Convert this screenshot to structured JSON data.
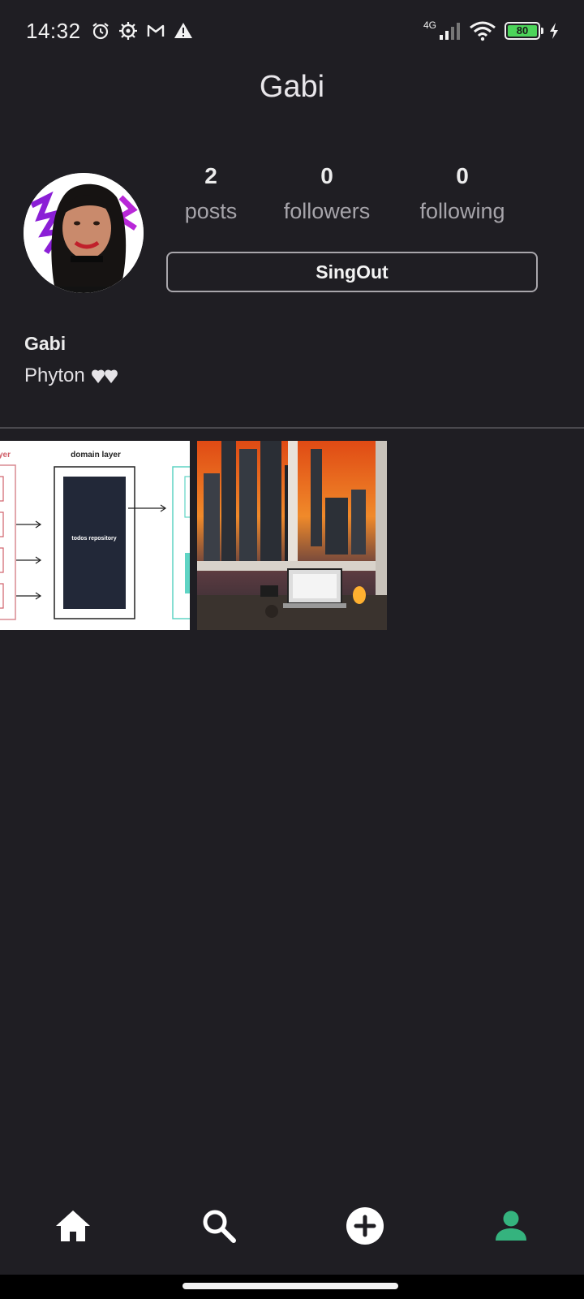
{
  "status_bar": {
    "time": "14:32",
    "icons_left": [
      "alarm-icon",
      "settings-icon",
      "gmail-icon",
      "warning-icon"
    ],
    "network": "4G",
    "battery": "80",
    "icons_right": [
      "signal-icon",
      "wifi-icon",
      "battery-icon",
      "charging-icon"
    ]
  },
  "app_bar": {
    "title": "Gabi"
  },
  "profile": {
    "stats": [
      {
        "value": "2",
        "label": "posts"
      },
      {
        "value": "0",
        "label": "followers"
      },
      {
        "value": "0",
        "label": "following"
      }
    ],
    "signout_label": "SingOut",
    "username": "Gabi",
    "bio": "Phyton"
  },
  "posts": [
    {
      "kind": "diagram",
      "header_left": "yer",
      "header": "domain layer",
      "box_label": "todos repository"
    },
    {
      "kind": "photo",
      "subject": "city-sunset-desk"
    }
  ],
  "bottom_nav": {
    "items": [
      "home-icon",
      "search-icon",
      "add-icon",
      "profile-icon"
    ],
    "active": "profile-icon",
    "active_color": "#35b37e"
  },
  "colors": {
    "background": "#1f1e23",
    "text": "#e8e6ea",
    "muted": "#a6a4aa",
    "accent": "#35b37e"
  }
}
